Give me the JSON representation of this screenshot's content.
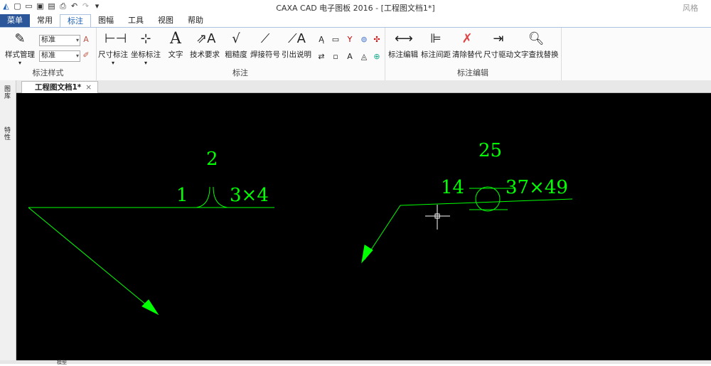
{
  "app": {
    "title": "CAXA CAD 电子图板 2016 - [工程图文档1*]",
    "style_label": "风格"
  },
  "quick_access": {
    "icons": [
      "logo-icon",
      "new-icon",
      "open-icon",
      "save-icon",
      "saveas-icon",
      "print-icon",
      "undo-icon",
      "redo-icon",
      "customize-icon"
    ]
  },
  "tabs": [
    {
      "label": "菜单"
    },
    {
      "label": "常用"
    },
    {
      "label": "标注"
    },
    {
      "label": "图幅"
    },
    {
      "label": "工具"
    },
    {
      "label": "视图"
    },
    {
      "label": "帮助"
    }
  ],
  "ribbon": {
    "style_group": {
      "label": "标注样式",
      "style_manage": "样式管理",
      "combo1": "标准",
      "combo2": "标准"
    },
    "annot_group": {
      "label": "标注",
      "dim": "尺寸标注",
      "coord": "坐标标注",
      "text": "文字",
      "tech": "技术要求",
      "rough": "粗糙度",
      "weld": "焊接符号",
      "leader": "引出说明"
    },
    "edit_group": {
      "label": "标注编辑",
      "edit": "标注编辑",
      "spacing": "标注间距",
      "clear": "清除替代",
      "drive": "尺寸驱动",
      "find": "文字查找替换"
    }
  },
  "document": {
    "tab": "工程图文档1*",
    "close": "×"
  },
  "sidebar": {
    "item1": "图库",
    "item2": "特性"
  },
  "drawing": {
    "weld1": {
      "top": "2",
      "left": "1",
      "right": "3×4"
    },
    "weld2": {
      "top": "25",
      "left": "14",
      "right": "37×49"
    }
  },
  "status": {
    "text": "模型"
  }
}
